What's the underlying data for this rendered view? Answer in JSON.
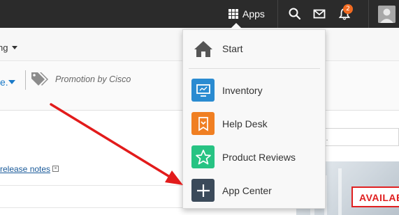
{
  "topbar": {
    "apps_label": "Apps",
    "notification_count": "2"
  },
  "subbar": {
    "menu_label": "ng"
  },
  "filterbar": {
    "fragment": "e.",
    "promo_label": "Promotion by Cisco"
  },
  "content": {
    "release_notes_link": "release notes",
    "release_close": "×",
    "search_placeholder": "h..."
  },
  "promo_badge": "AVAILAB",
  "apps_menu": {
    "items": [
      {
        "label": "Start",
        "icon": "home-icon",
        "color": "#555555"
      },
      {
        "label": "Inventory",
        "icon": "monitor-icon",
        "color": "#2a8bd1"
      },
      {
        "label": "Help Desk",
        "icon": "helpdesk-icon",
        "color": "#f07f22"
      },
      {
        "label": "Product Reviews",
        "icon": "star-icon",
        "color": "#27c383"
      },
      {
        "label": "App Center",
        "icon": "plus-icon",
        "color": "#3b4a5a"
      }
    ]
  },
  "colors": {
    "topbar": "#2b2b2b",
    "accent": "#1a7ac8",
    "badge": "#f26b21",
    "annotation_arrow": "#e21b1b"
  }
}
